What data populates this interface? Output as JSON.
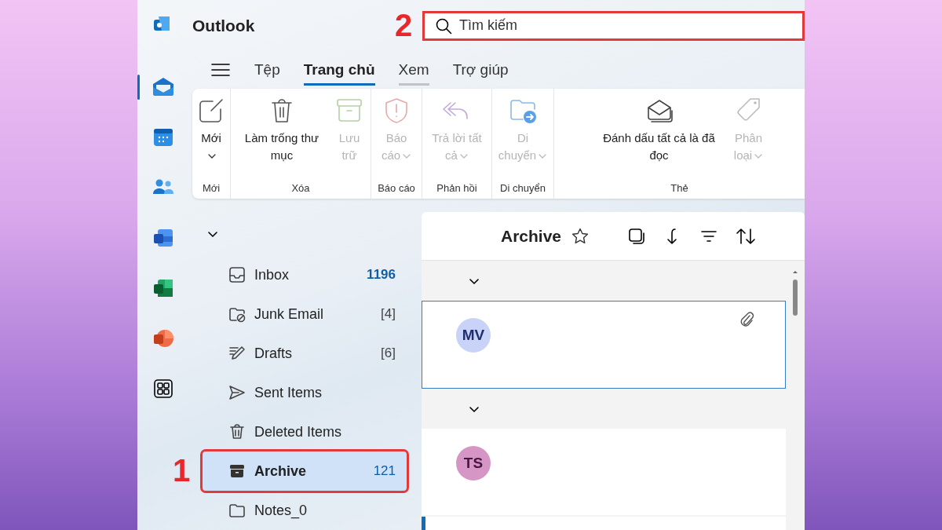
{
  "app": {
    "title": "Outlook"
  },
  "rail": [
    {
      "kind": "logo",
      "selected": false
    },
    {
      "kind": "mail",
      "selected": true
    },
    {
      "kind": "calendar",
      "selected": false
    },
    {
      "kind": "people",
      "selected": false
    },
    {
      "kind": "document",
      "selected": false
    },
    {
      "kind": "spreadsheet",
      "selected": false
    },
    {
      "kind": "presentation",
      "selected": false
    },
    {
      "kind": "apps",
      "selected": false
    }
  ],
  "search": {
    "placeholder": "Tìm kiếm",
    "callout": "2"
  },
  "tabs": [
    {
      "label": "Tệp",
      "selected": false,
      "hovered": false
    },
    {
      "label": "Trang chủ",
      "selected": true,
      "hovered": false
    },
    {
      "label": "Xem",
      "selected": false,
      "hovered": true
    },
    {
      "label": "Trợ giúp",
      "selected": false,
      "hovered": false
    }
  ],
  "ribbon": [
    {
      "label": "Mới",
      "buttons": [
        {
          "kind": "new",
          "label": "Mới",
          "disabled": false,
          "dropdown": true
        }
      ]
    },
    {
      "label": "Xóa",
      "buttons": [
        {
          "kind": "empty",
          "label": "Làm trống thư mục",
          "disabled": false,
          "dropdown": false
        },
        {
          "kind": "archive",
          "label": "Lưu trữ",
          "disabled": true,
          "dropdown": false
        }
      ]
    },
    {
      "label": "Báo cáo",
      "buttons": [
        {
          "kind": "report",
          "label": "Báo cáo",
          "disabled": true,
          "dropdown": true
        }
      ]
    },
    {
      "label": "Phản hồi",
      "buttons": [
        {
          "kind": "reply",
          "label": "Trả lời tất cả",
          "disabled": true,
          "dropdown": true
        }
      ]
    },
    {
      "label": "Di chuyển",
      "buttons": [
        {
          "kind": "move",
          "label": "Di chuyển",
          "disabled": true,
          "dropdown": true
        }
      ]
    },
    {
      "label": "Thẻ",
      "buttons": [
        {
          "kind": "markread",
          "label": "Đánh dấu tất cả là đã đọc",
          "disabled": false,
          "dropdown": false
        },
        {
          "kind": "categorize",
          "label": "Phân loại",
          "disabled": true,
          "dropdown": true
        }
      ]
    }
  ],
  "folders": {
    "account_expanded": true,
    "items": [
      {
        "kind": "inbox",
        "label": "Inbox",
        "count": "1196",
        "unread": true,
        "selected": false
      },
      {
        "kind": "junk",
        "label": "Junk Email",
        "count": "[4]",
        "unread": false,
        "selected": false
      },
      {
        "kind": "drafts",
        "label": "Drafts",
        "count": "[6]",
        "unread": false,
        "selected": false
      },
      {
        "kind": "sent",
        "label": "Sent Items",
        "selected": false
      },
      {
        "kind": "deleted",
        "label": "Deleted Items",
        "selected": false
      },
      {
        "kind": "archive",
        "label": "Archive",
        "count": "121",
        "unread": true,
        "selected": true,
        "callout": "1"
      },
      {
        "kind": "folder",
        "label": "Notes_0",
        "selected": false
      }
    ]
  },
  "message_list": {
    "title": "Archive",
    "favorite": false,
    "groups": [
      {
        "expanded": true,
        "messages": [
          {
            "initials": "MV",
            "color": "#c9d2f7",
            "selected": true,
            "attachment": true,
            "unread": false
          }
        ]
      },
      {
        "expanded": true,
        "messages": [
          {
            "initials": "TS",
            "color": "#d596c5",
            "selected": false,
            "attachment": false,
            "unread": false
          },
          {
            "selected": false,
            "attachment": false,
            "unread": true
          }
        ]
      }
    ]
  }
}
